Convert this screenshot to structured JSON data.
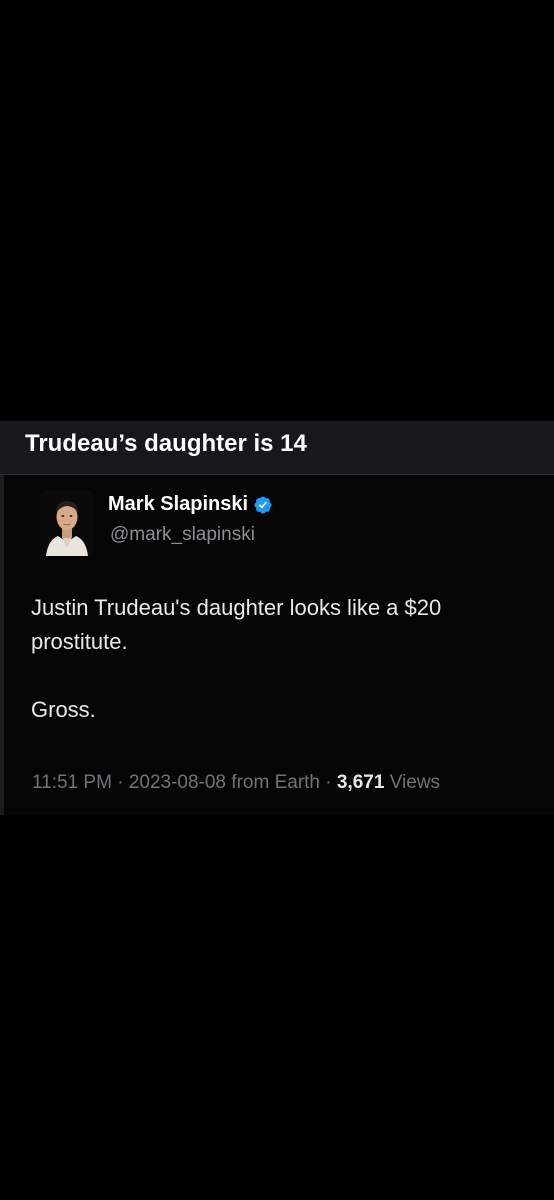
{
  "header": {
    "title": "Trudeau’s daughter is 14"
  },
  "tweet": {
    "author": {
      "display_name": "Mark Slapinski",
      "handle": "@mark_slapinski",
      "verified_icon": "verified-badge-icon",
      "verified_color": "#1d9bf0"
    },
    "body": {
      "line1": "Justin Trudeau's daughter looks like a $20 prostitute.",
      "line2": "Gross."
    },
    "meta": {
      "time": "11:51 PM",
      "separator1": " · ",
      "date": "2023-08-08",
      "source": " from Earth",
      "separator2": " · ",
      "views_count": "3,671",
      "views_label": " Views"
    }
  },
  "colors": {
    "background": "#000000",
    "title_bar": "#16181c",
    "text_primary": "#e7e9ea",
    "text_secondary": "#8b8f93",
    "accent": "#1d9bf0"
  }
}
